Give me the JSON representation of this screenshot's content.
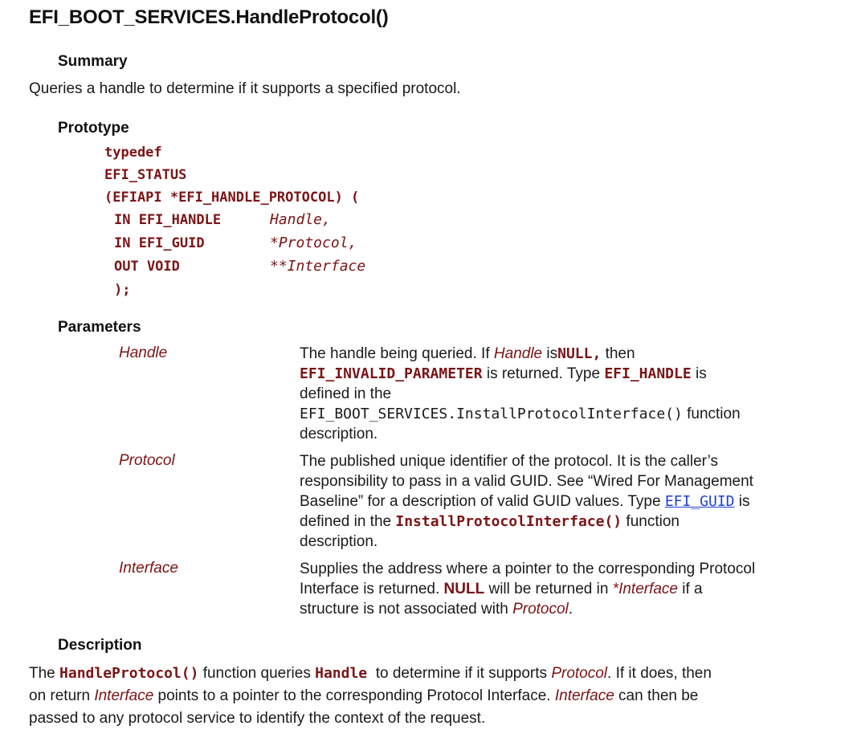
{
  "title": "EFI_BOOT_SERVICES.HandleProtocol()",
  "summary": {
    "heading": "Summary",
    "text": "Queries a handle to determine if it supports a specified protocol."
  },
  "prototype": {
    "heading": "Prototype",
    "line1": "typedef",
    "line2": "EFI_STATUS",
    "line3": "(EFIAPI *EFI_HANDLE_PROTOCOL) (",
    "args": [
      {
        "dir_type": "IN EFI_HANDLE",
        "name": "Handle,"
      },
      {
        "dir_type": "IN EFI_GUID",
        "name": "*Protocol,"
      },
      {
        "dir_type": "OUT VOID",
        "name": "**Interface"
      }
    ],
    "close": ");"
  },
  "parameters": {
    "heading": "Parameters",
    "handle": {
      "name": "Handle",
      "t1": "The handle being queried. If ",
      "t1_it": "Handle",
      "t1_b": " is",
      "t1_code": "NULL,",
      "t1_end": " then",
      "t2_code": "EFI_INVALID_PARAMETER",
      "t2": " is returned. Type ",
      "t2_code2": "EFI_HANDLE",
      "t2_end": " is",
      "t3": "defined in the",
      "t4_mono": "EFI_BOOT_SERVICES.InstallProtocolInterface()",
      "t4_end": " function",
      "t5": "description."
    },
    "protocol": {
      "name": "Protocol",
      "t1": "The published unique identifier of the protocol. It is the caller’s",
      "t2": "responsibility to pass in a valid GUID. See “Wired For Management",
      "t3": "Baseline” for a description of valid GUID values. Type ",
      "t3_link": "EFI_GUID",
      "t3_end": " is",
      "t4": "defined in the ",
      "t4_code": "InstallProtocolInterface()",
      "t4_end": " function",
      "t5": "description."
    },
    "interface": {
      "name": "Interface",
      "t1": "Supplies the address where a pointer to the corresponding Protocol",
      "t2": "Interface is returned. ",
      "t2_code": "NULL",
      "t2_mid": " will be returned in ",
      "t2_it": "*Interface",
      "t2_end": " if a",
      "t3": "structure is not associated with ",
      "t3_it": "Protocol",
      "t3_end": "."
    }
  },
  "description": {
    "heading": "Description",
    "p1": "The ",
    "p1_code": "HandleProtocol()",
    "p1_b": " function queries ",
    "p1_code2": "Handle",
    "p1_c": "  to determine if it supports ",
    "p1_it": "Protocol",
    "p1_d": ". If it does, then",
    "p2": "on return ",
    "p2_it": "Interface",
    "p2_b": " points to a pointer to the corresponding Protocol Interface. ",
    "p2_it2": "Interface",
    "p2_c": " can then be",
    "p3": "passed to any protocol service to identify the context of the request."
  },
  "colors": {
    "code": "#7b1416",
    "link": "#1f3fd6",
    "text": "#1a1a1a"
  }
}
